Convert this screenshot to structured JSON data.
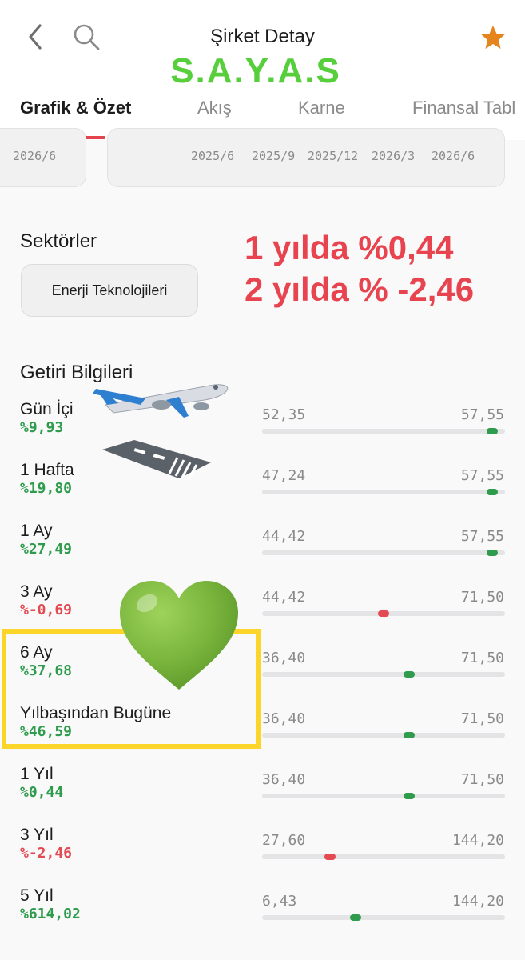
{
  "header": {
    "title": "Şirket Detay",
    "overlay_ticker": "S.A.Y.A.S",
    "icons": {
      "back": "chevron-left-icon",
      "search": "search-icon",
      "favorite": "star-icon"
    },
    "colors": {
      "favorite": "#e5851c",
      "overlay_ticker": "#57cf3c",
      "accent": "#e3444d"
    }
  },
  "tabs": [
    {
      "label": "Grafik & Özet",
      "active": true
    },
    {
      "label": "Akış",
      "active": false
    },
    {
      "label": "Karne",
      "active": false
    },
    {
      "label": "Finansal Tabl",
      "active": false
    }
  ],
  "chart_strip": {
    "left_tick": "2026/6",
    "ticks": [
      "2025/6",
      "2025/9",
      "2025/12",
      "2026/3",
      "2026/6"
    ]
  },
  "sectors": {
    "title": "Sektörler",
    "chip": "Enerji Teknolojileri"
  },
  "overlay_text": {
    "line1": "1 yılda %0,44",
    "line2": "2 yılda % -2,46",
    "color": "#e84450"
  },
  "returns": {
    "title": "Getiri Bilgileri",
    "rows": [
      {
        "label": "Gün İçi",
        "pct": "%9,93",
        "sign": "pos",
        "low": "52,35",
        "high": "57,55",
        "position": 0.97
      },
      {
        "label": "1 Hafta",
        "pct": "%19,80",
        "sign": "pos",
        "low": "47,24",
        "high": "57,55",
        "position": 0.97
      },
      {
        "label": "1 Ay",
        "pct": "%27,49",
        "sign": "pos",
        "low": "44,42",
        "high": "57,55",
        "position": 0.97
      },
      {
        "label": "3 Ay",
        "pct": "%-0,69",
        "sign": "neg",
        "low": "44,42",
        "high": "71,50",
        "position": 0.5
      },
      {
        "label": "6 Ay",
        "pct": "%37,68",
        "sign": "pos",
        "low": "36,40",
        "high": "71,50",
        "position": 0.61
      },
      {
        "label": "Yılbaşından Bugüne",
        "pct": "%46,59",
        "sign": "pos",
        "low": "36,40",
        "high": "71,50",
        "position": 0.61
      },
      {
        "label": "1 Yıl",
        "pct": "%0,44",
        "sign": "pos",
        "low": "36,40",
        "high": "71,50",
        "position": 0.61
      },
      {
        "label": "3 Yıl",
        "pct": "%-2,46",
        "sign": "neg",
        "low": "27,60",
        "high": "144,20",
        "position": 0.27
      },
      {
        "label": "5 Yıl",
        "pct": "%614,02",
        "sign": "pos",
        "low": "6,43",
        "high": "144,20",
        "position": 0.38
      }
    ]
  },
  "stickers": {
    "plane": "airplane-icon",
    "runway": "runway-icon",
    "heart": "green-heart-icon",
    "highlight_color": "#fcd52b"
  }
}
